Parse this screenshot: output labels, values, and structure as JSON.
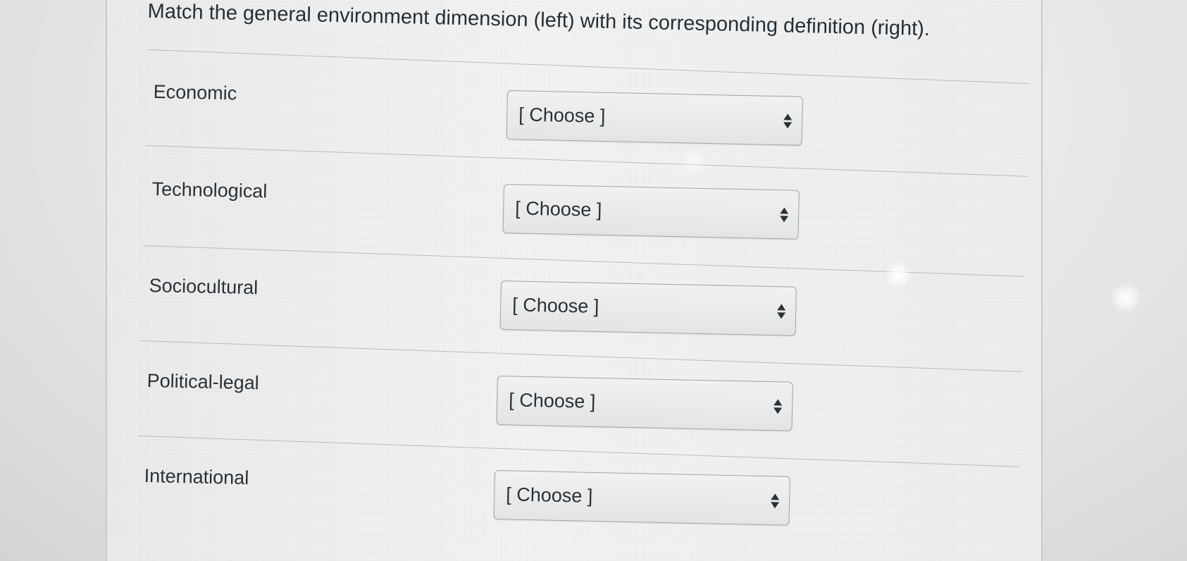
{
  "question": {
    "prompt": "Match the general environment dimension (left) with its corresponding definition (right)."
  },
  "rows": [
    {
      "label": "Economic",
      "select_value": "[ Choose ]"
    },
    {
      "label": "Technological",
      "select_value": "[ Choose ]"
    },
    {
      "label": "Sociocultural",
      "select_value": "[ Choose ]"
    },
    {
      "label": "Political-legal",
      "select_value": "[ Choose ]"
    },
    {
      "label": "International",
      "select_value": "[ Choose ]"
    }
  ],
  "icons": {
    "select_arrows": "up-down-arrows-icon"
  }
}
